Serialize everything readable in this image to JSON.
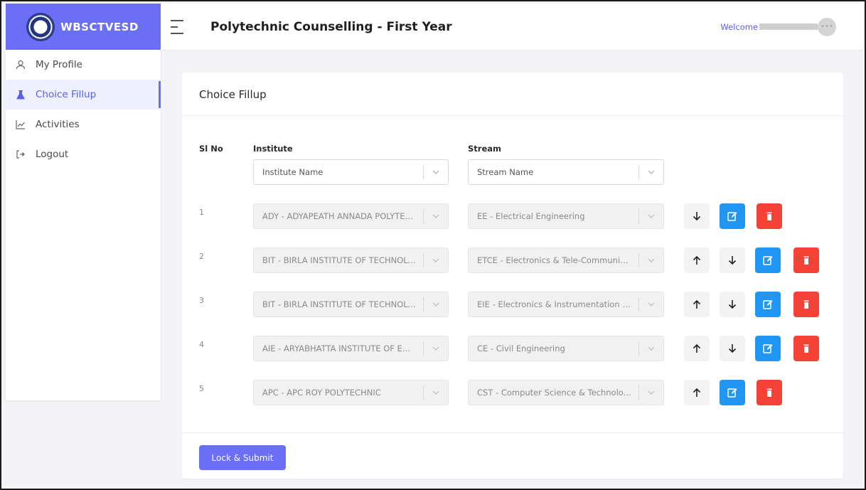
{
  "brand": {
    "name": "WBSCTVESD"
  },
  "header": {
    "title": "Polytechnic Counselling - First Year",
    "welcome": "Welcome"
  },
  "sidebar": {
    "items": [
      {
        "label": "My Profile",
        "icon": "user-icon",
        "active": false
      },
      {
        "label": "Choice Fillup",
        "icon": "flask-icon",
        "active": true
      },
      {
        "label": "Activities",
        "icon": "chart-line-icon",
        "active": false
      },
      {
        "label": "Logout",
        "icon": "logout-icon",
        "active": false
      }
    ]
  },
  "card": {
    "title": "Choice Fillup",
    "columns": {
      "slno": "Sl No",
      "institute": "Institute",
      "stream": "Stream"
    },
    "filters": {
      "institute_placeholder": "Institute Name",
      "stream_placeholder": "Stream Name"
    },
    "rows": [
      {
        "slno": "1",
        "institute": "ADY - ADYAPEATH ANNADA POLYTECH...",
        "stream": "EE - Electrical Engineering",
        "up": false,
        "down": true
      },
      {
        "slno": "2",
        "institute": "BIT - BIRLA INSTITUTE OF TECHNOLOGY",
        "stream": "ETCE - Electronics & Tele-Communic...",
        "up": true,
        "down": true
      },
      {
        "slno": "3",
        "institute": "BIT - BIRLA INSTITUTE OF TECHNOLOGY",
        "stream": "EIE - Electronics & Instrumentation En...",
        "up": true,
        "down": true
      },
      {
        "slno": "4",
        "institute": "AIE - ARYABHATTA INSTITUTE OF ENGG...",
        "stream": "CE - Civil Engineering",
        "up": true,
        "down": true
      },
      {
        "slno": "5",
        "institute": "APC - APC ROY POLYTECHNIC",
        "stream": "CST - Computer Science & Technolo...",
        "up": true,
        "down": false
      }
    ],
    "submit_label": "Lock & Submit"
  },
  "colors": {
    "accent": "#6b6ff5",
    "edit": "#2196f3",
    "delete": "#f44336"
  }
}
